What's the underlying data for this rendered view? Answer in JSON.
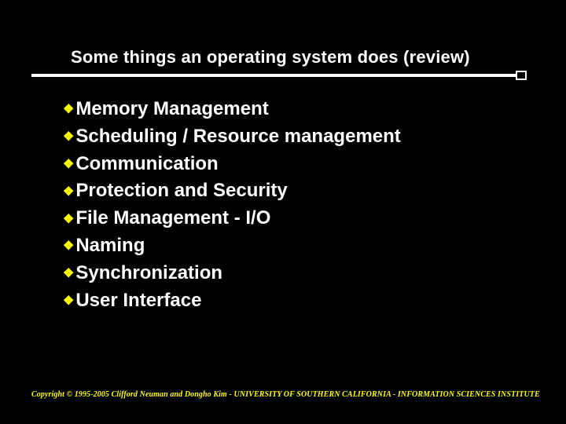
{
  "slide": {
    "title": "Some things  an operating system does (review)",
    "bullets": [
      "Memory Management",
      "Scheduling / Resource management",
      "Communication",
      "Protection and Security",
      "File Management - I/O",
      "Naming",
      "Synchronization",
      "User Interface"
    ],
    "footer": "Copyright © 1995-2005 Clifford Neuman and Dongho Kim - UNIVERSITY OF SOUTHERN CALIFORNIA - INFORMATION SCIENCES INSTITUTE"
  }
}
